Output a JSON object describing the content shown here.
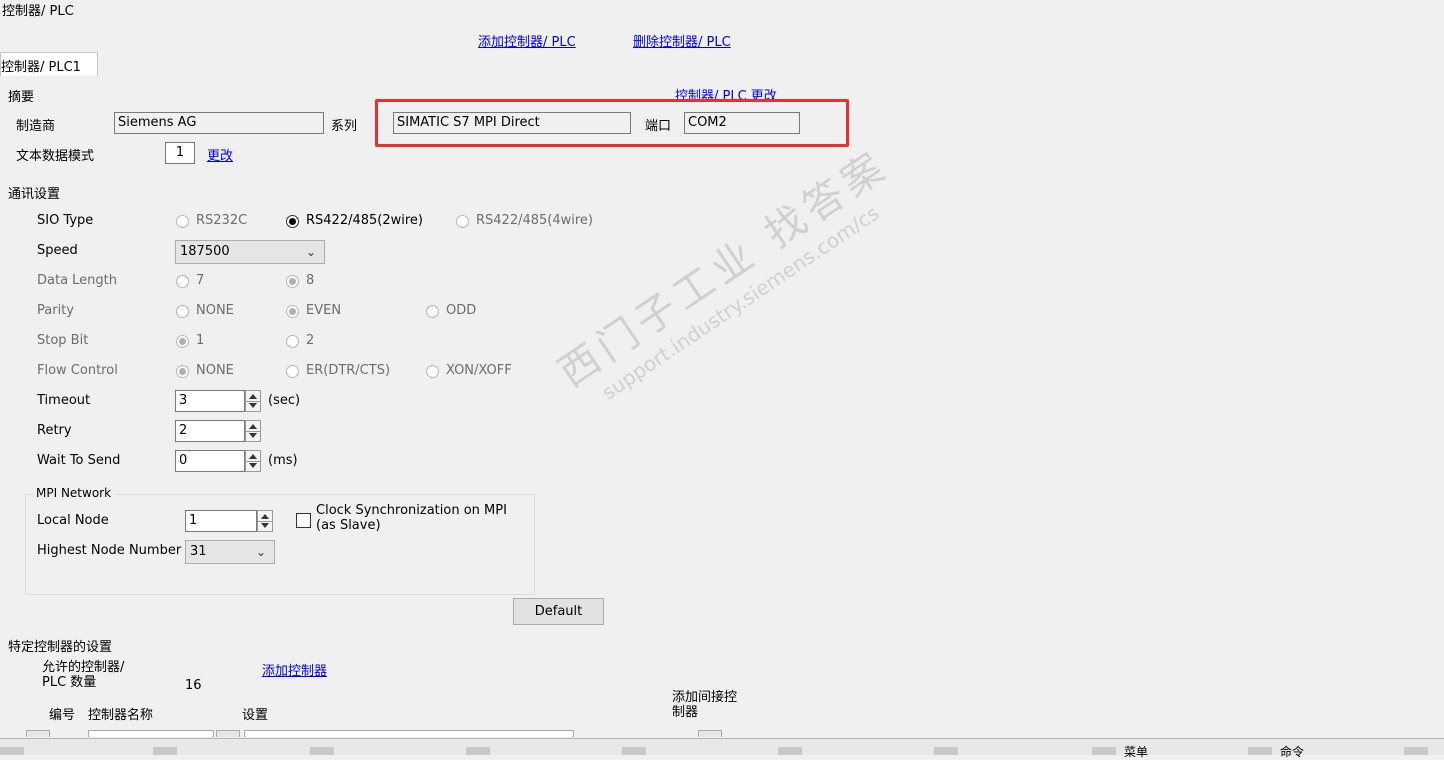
{
  "header": {
    "title": "控制器/ PLC",
    "add_link": "添加控制器/ PLC",
    "delete_link": "删除控制器/ PLC"
  },
  "tab": {
    "label": "控制器/ PLC1"
  },
  "summary": {
    "heading": "摘要",
    "change_link": "控制器/ PLC 更改",
    "manufacturer_label": "制造商",
    "manufacturer_value": "Siemens AG",
    "series_label": "系列",
    "series_value": "SIMATIC S7 MPI Direct",
    "port_label": "端口",
    "port_value": "COM2",
    "text_mode_label": "文本数据模式",
    "text_mode_value": "1",
    "text_mode_change": "更改",
    "highlight_color": "#e8312a"
  },
  "comm": {
    "heading": "通讯设置",
    "sio_type": {
      "label": "SIO Type",
      "options": [
        "RS232C",
        "RS422/485(2wire)",
        "RS422/485(4wire)"
      ],
      "selected": "RS422/485(2wire)"
    },
    "speed": {
      "label": "Speed",
      "value": "187500"
    },
    "data_length": {
      "label": "Data Length",
      "options": [
        "7",
        "8"
      ],
      "selected": "8"
    },
    "parity": {
      "label": "Parity",
      "options": [
        "NONE",
        "EVEN",
        "ODD"
      ],
      "selected": "EVEN"
    },
    "stop_bit": {
      "label": "Stop Bit",
      "options": [
        "1",
        "2"
      ],
      "selected": "1"
    },
    "flow_control": {
      "label": "Flow Control",
      "options": [
        "NONE",
        "ER(DTR/CTS)",
        "XON/XOFF"
      ],
      "selected": "NONE"
    },
    "timeout": {
      "label": "Timeout",
      "value": "3",
      "unit": "(sec)"
    },
    "retry": {
      "label": "Retry",
      "value": "2"
    },
    "wait_to_send": {
      "label": "Wait To Send",
      "value": "0",
      "unit": "(ms)"
    }
  },
  "mpi": {
    "heading": "MPI Network",
    "local_node": {
      "label": "Local Node",
      "value": "1"
    },
    "highest_node": {
      "label": "Highest Node Number",
      "value": "31"
    },
    "clock_sync_line1": "Clock Synchronization  on MPI",
    "clock_sync_line2": "(as Slave)",
    "default_button": "Default"
  },
  "specific": {
    "heading": "特定控制器的设置",
    "allowed_label_line1": "允许的控制器/",
    "allowed_label_line2": "PLC 数量",
    "allowed_value": "16",
    "add_controller_link": "添加控制器",
    "col_number": "编号",
    "col_name": "控制器名称",
    "col_settings": "设置",
    "add_indirect_line1": "添加间接控",
    "add_indirect_line2": "制器"
  },
  "watermark": {
    "text1": "西门子工业  找答案",
    "text2": "support.industry.siemens.com/cs"
  },
  "bottom_bar": {
    "items": [
      "菜单",
      "命令"
    ]
  }
}
